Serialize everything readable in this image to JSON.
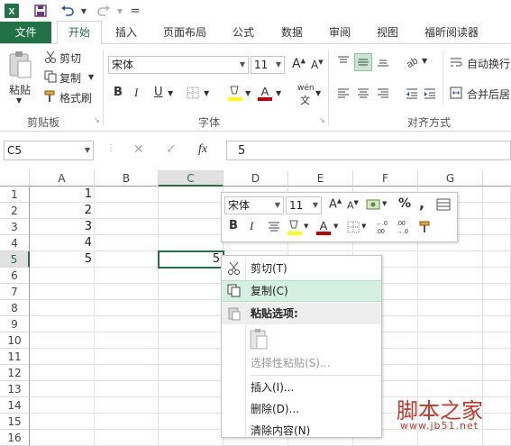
{
  "qat": {
    "excel_logo": "X",
    "save_icon": "save-icon",
    "undo_icon": "undo-icon",
    "redo_icon": "redo-icon",
    "customize": "="
  },
  "tabs": [
    "文件",
    "开始",
    "插入",
    "页面布局",
    "公式",
    "数据",
    "审阅",
    "视图",
    "福昕阅读器"
  ],
  "ribbon": {
    "clipboard": {
      "paste": "粘贴",
      "cut": "剪切",
      "copy": "复制",
      "format_painter": "格式刷",
      "group_label": "剪贴板"
    },
    "font": {
      "font_name": "宋体",
      "font_size": "11",
      "bold": "B",
      "italic": "I",
      "underline": "U",
      "phonetic": "wén",
      "group_label": "字体"
    },
    "alignment": {
      "wrap_text": "自动换行",
      "merge_center": "合并后居",
      "group_label": "对齐方式"
    }
  },
  "formula_bar": {
    "name_box": "C5",
    "fx": "fx",
    "value": "5"
  },
  "grid": {
    "columns": [
      "A",
      "B",
      "C",
      "D",
      "E",
      "F",
      "G"
    ],
    "rows": [
      "1",
      "2",
      "3",
      "4",
      "5",
      "6",
      "7",
      "8",
      "9",
      "10",
      "11",
      "12",
      "13",
      "14",
      "15",
      "16"
    ],
    "a_values": [
      "1",
      "2",
      "3",
      "4",
      "5"
    ],
    "c5_value": "5"
  },
  "mini_toolbar": {
    "font_name": "宋体",
    "font_size": "11",
    "percent": "%",
    "comma": ",",
    "bold": "B",
    "italic": "I"
  },
  "context_menu": {
    "cut": "剪切(T)",
    "copy": "复制(C)",
    "paste_options": "粘贴选项:",
    "paste_special": "选择性粘贴(S)...",
    "insert": "插入(I)...",
    "delete": "删除(D)...",
    "clear": "清除内容(N)"
  },
  "watermark": {
    "title": "脚本之家",
    "url": "www.jb51.net"
  },
  "colors": {
    "accent": "#217346",
    "highlight_yellow": "#ffff00",
    "font_red": "#c00000",
    "menu_hover": "#d3f0e0"
  }
}
